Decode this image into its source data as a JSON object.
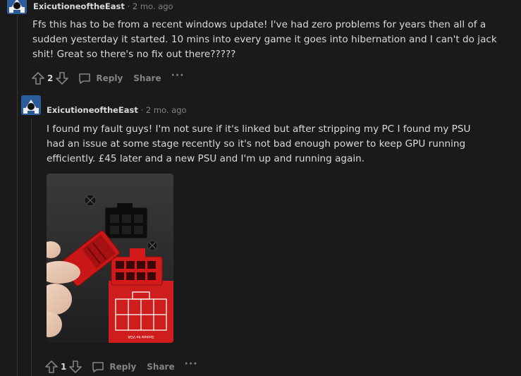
{
  "comments": [
    {
      "author": "ExicutioneoftheEast",
      "separator": "·",
      "time": "2 mo. ago",
      "body_lines": [
        "Ffs this has to be from a recent windows update! I've had zero problems for years then all of a",
        "sudden yesterday it started. 10 mins into every game it goes into hibernation and I can't do jack",
        "shit! Great so there's no fix out there?????"
      ],
      "votes": "2",
      "reply_label": "Reply",
      "share_label": "Share",
      "more_label": "···"
    },
    {
      "author": "ExicutioneoftheEast",
      "separator": "·",
      "time": "2 mo. ago",
      "body_lines": [
        "I found my fault guys! I'm not sure if it's linked but after stripping my PC I found my PSU",
        "had an issue at some stage recently so it's not bad enough power to keep GPU running",
        "efficiently. £45 later and a new PSU and I'm up and running again."
      ],
      "image_text": "Sockets for VGA",
      "votes": "1",
      "reply_label": "Reply",
      "share_label": "Share",
      "more_label": "···"
    }
  ],
  "colors": {
    "background": "#1a1a1b",
    "text": "#d7dadc",
    "muted": "#818384",
    "thread_line": "#343536",
    "connector_red": "#d21a1a"
  },
  "icons": [
    "avatar",
    "upvote-icon",
    "downvote-icon",
    "comment-icon",
    "more-icon"
  ]
}
